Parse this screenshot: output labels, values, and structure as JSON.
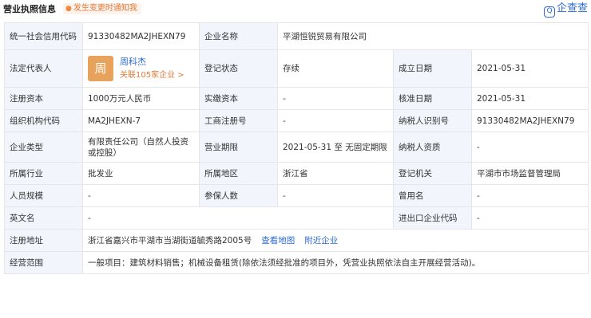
{
  "header": {
    "title": "营业执照信息",
    "notify_label": "发生变更时通知我",
    "logo_text": "企查查"
  },
  "rows": [
    [
      "统一社会信用代码",
      "91330482MA2JHEXN79",
      "企业名称",
      "平湖恒锐贸易有限公司"
    ],
    [
      "法定代表人",
      "",
      "登记状态",
      "存续",
      "成立日期",
      "2021-05-31"
    ],
    [
      "注册资本",
      "1000万元人民币",
      "实缴资本",
      "-",
      "核准日期",
      "2021-05-31"
    ],
    [
      "组织机构代码",
      "MA2JHEXN-7",
      "工商注册号",
      "-",
      "纳税人识别号",
      "91330482MA2JHEXN79"
    ],
    [
      "企业类型",
      "有限责任公司（自然人投资或控股）",
      "营业期限",
      "2021-05-31 至 无固定期限",
      "纳税人资质",
      "-"
    ],
    [
      "所属行业",
      "批发业",
      "所属地区",
      "浙江省",
      "登记机关",
      "平湖市市场监督管理局"
    ],
    [
      "人员规模",
      "-",
      "参保人数",
      "-",
      "曾用名",
      "-"
    ],
    [
      "英文名",
      "-",
      "进出口企业代码",
      "-"
    ],
    [
      "注册地址",
      "浙江省嘉兴市平湖市当湖街道毓秀路2005号",
      "查看地图",
      "附近企业"
    ],
    [
      "经营范围",
      "一般项目：建筑材料销售；机械设备租赁(除依法须经批准的项目外，凭营业执照依法自主开展经营活动)。"
    ]
  ],
  "representative": {
    "avatar_char": "周",
    "name": "周科杰",
    "related": "关联105家企业 >"
  },
  "colors": {
    "label_bg": "#f2f6fc",
    "link": "#2b6ad6",
    "accent": "#e07b39",
    "avatar": "#e7a25b",
    "border": "#e4e6ea"
  }
}
